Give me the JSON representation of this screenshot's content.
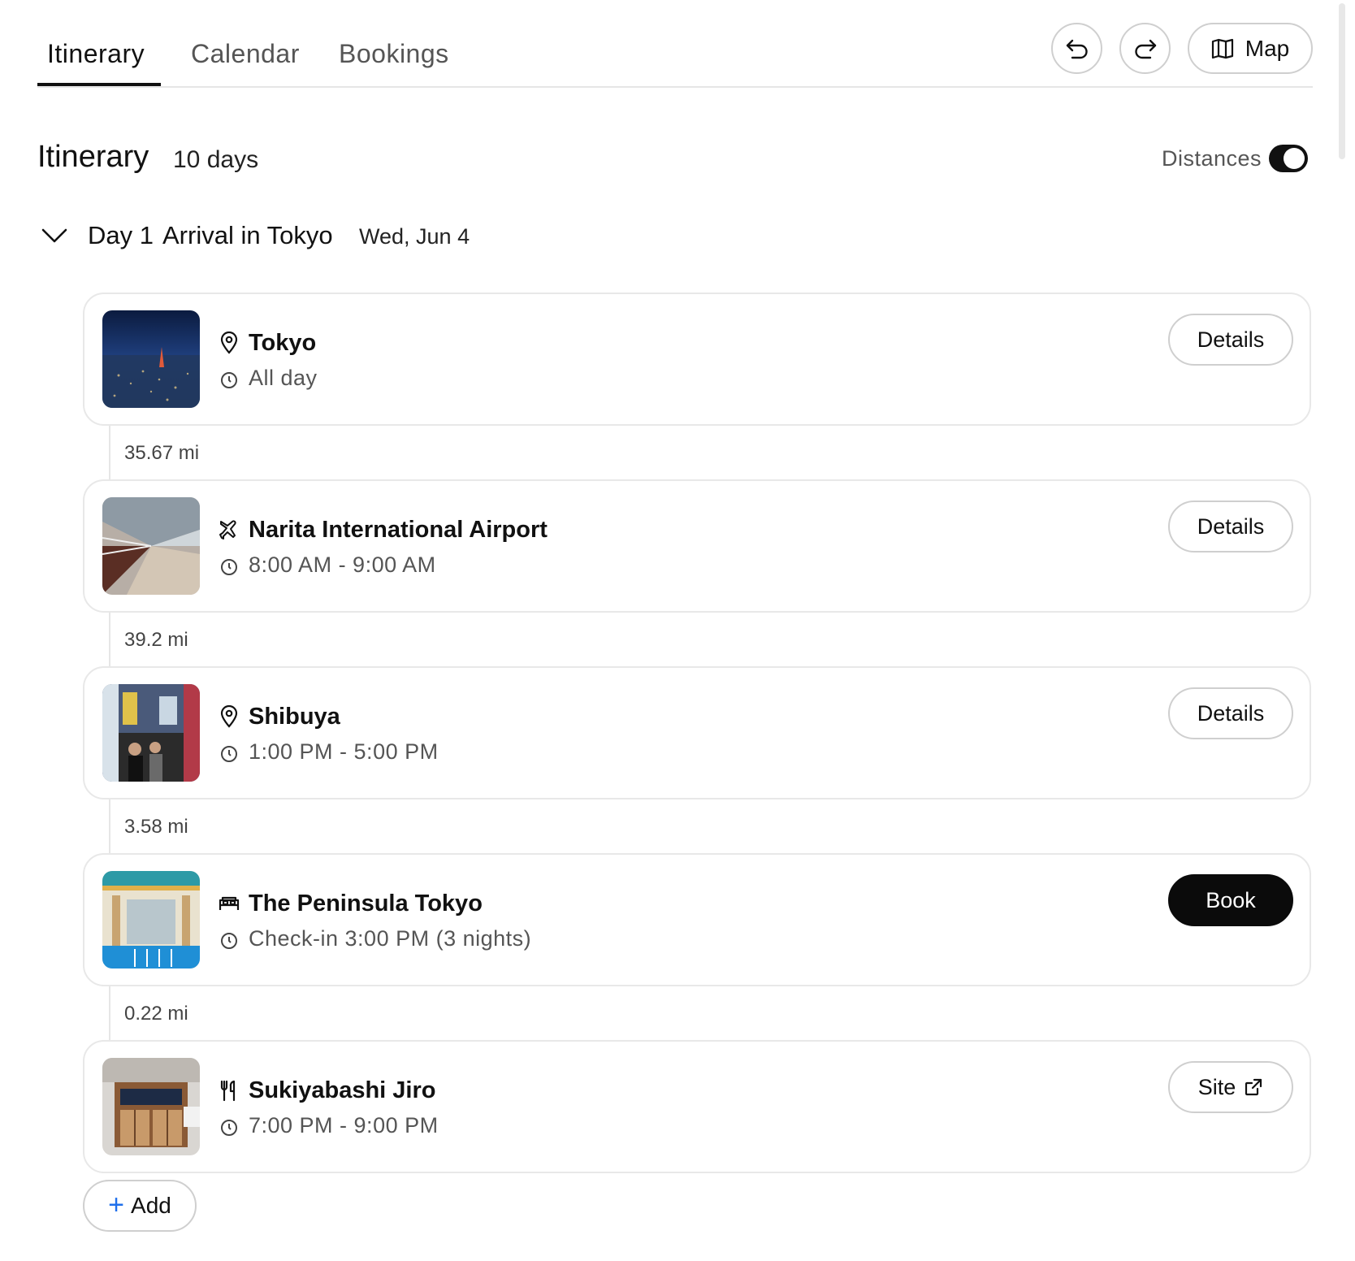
{
  "tabs": [
    {
      "label": "Itinerary",
      "active": true
    },
    {
      "label": "Calendar",
      "active": false
    },
    {
      "label": "Bookings",
      "active": false
    }
  ],
  "toolbar": {
    "undo_icon": "undo-icon",
    "redo_icon": "redo-icon",
    "map_label": "Map",
    "map_icon": "map-icon"
  },
  "header": {
    "title": "Itinerary",
    "subtitle": "10 days",
    "distances_label": "Distances",
    "distances_on": true
  },
  "day": {
    "number": "Day 1",
    "title": "Arrival in Tokyo",
    "date": "Wed, Jun 4",
    "expanded": true
  },
  "items": [
    {
      "title": "Tokyo",
      "time": "All day",
      "icon": "pin-icon",
      "action": "Details",
      "action_style": "outline"
    },
    {
      "title": "Narita International Airport",
      "time": "8:00 AM - 9:00 AM",
      "icon": "plane-icon",
      "action": "Details",
      "action_style": "outline"
    },
    {
      "title": "Shibuya",
      "time": "1:00 PM - 5:00 PM",
      "icon": "pin-icon",
      "action": "Details",
      "action_style": "outline"
    },
    {
      "title": "The Peninsula Tokyo",
      "time": "Check-in 3:00 PM (3 nights)",
      "icon": "bed-icon",
      "action": "Book",
      "action_style": "filled"
    },
    {
      "title": "Sukiyabashi Jiro",
      "time": "7:00 PM - 9:00 PM",
      "icon": "utensils-icon",
      "action": "Site",
      "action_style": "outline-external"
    }
  ],
  "distances": [
    "35.67 mi",
    "39.2 mi",
    "3.58 mi",
    "0.22 mi"
  ],
  "add_label": "Add",
  "colors": {
    "accent_plus": "#1f6feb",
    "book_button": "#0b0b0b",
    "border": "#e8e8e8"
  }
}
